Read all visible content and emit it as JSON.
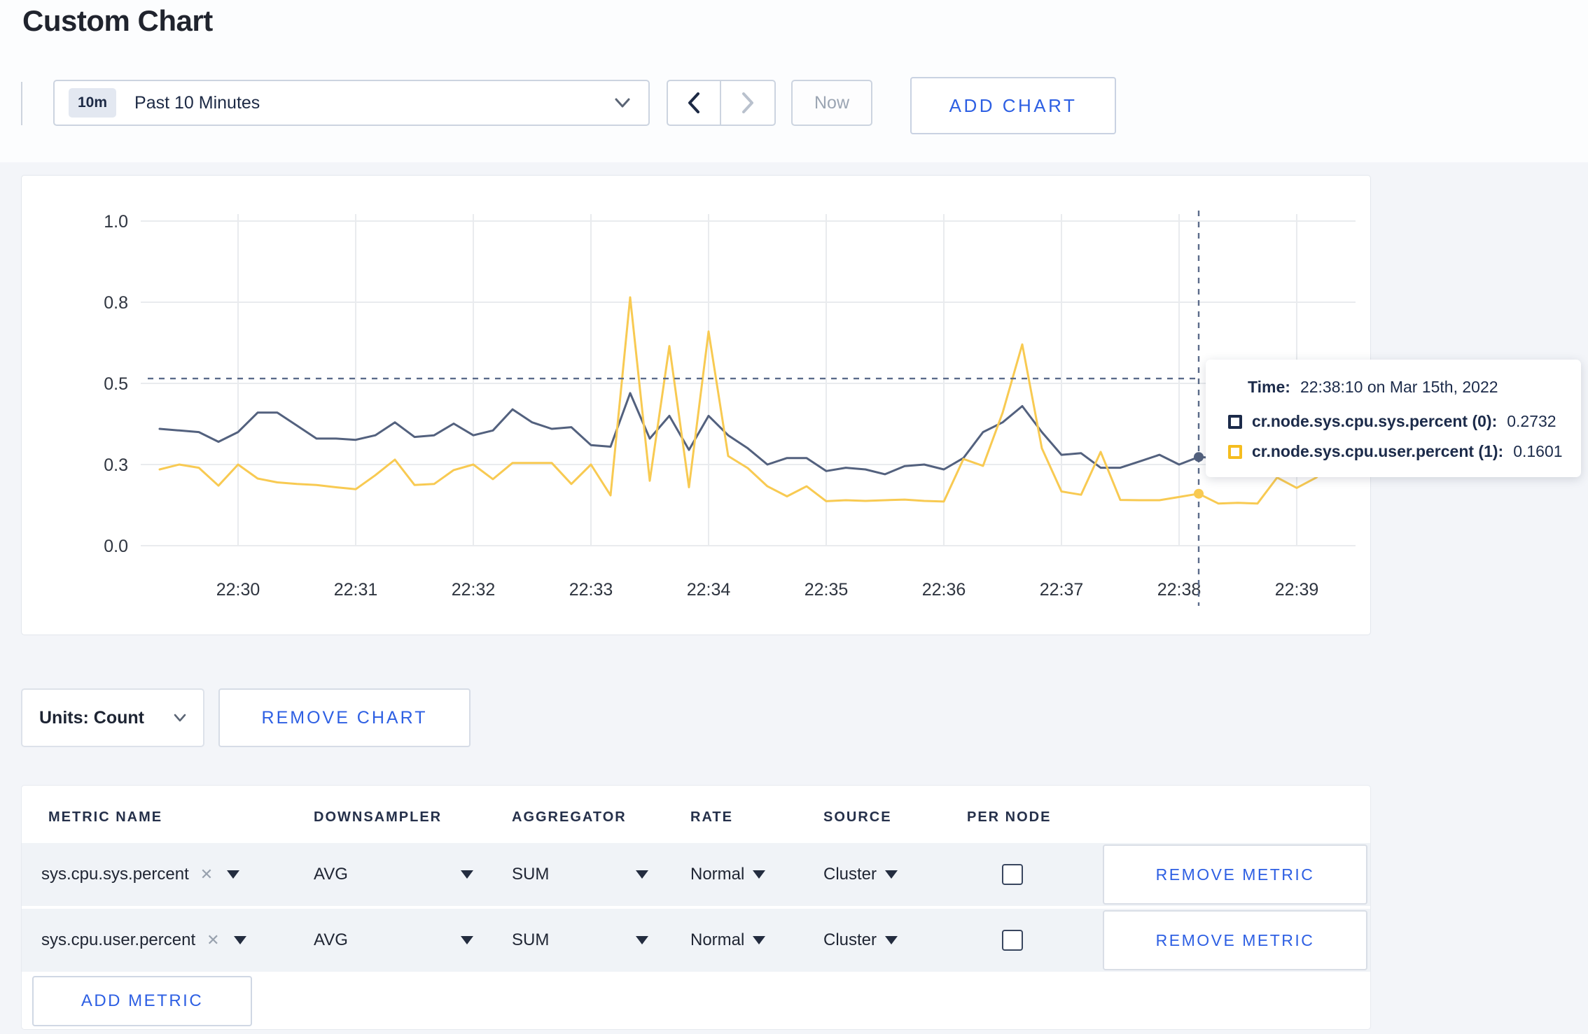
{
  "page": {
    "title": "Custom Chart"
  },
  "toolbar": {
    "time_badge": "10m",
    "time_label": "Past 10 Minutes",
    "now_label": "Now",
    "add_chart_label": "ADD CHART"
  },
  "chart_data": {
    "type": "line",
    "title": "",
    "xlabel": "",
    "ylabel": "",
    "ylim": [
      0,
      1
    ],
    "grid": true,
    "x_start_time": "22:29:20",
    "sample_interval_seconds": 10,
    "x_ticks": [
      "22:30",
      "22:31",
      "22:32",
      "22:33",
      "22:34",
      "22:35",
      "22:36",
      "22:37",
      "22:38",
      "22:39"
    ],
    "y_tick_labels": [
      "0.0",
      "0.3",
      "0.5",
      "0.8",
      "1.0"
    ],
    "y_tick_values": [
      0,
      0.25,
      0.5,
      0.75,
      1.0
    ],
    "series": [
      {
        "name": "cr.node.sys.cpu.sys.percent (0)",
        "color": "#53617e",
        "values": [
          0.36,
          0.355,
          0.35,
          0.32,
          0.35,
          0.41,
          0.41,
          0.37,
          0.33,
          0.33,
          0.326,
          0.34,
          0.38,
          0.335,
          0.34,
          0.376,
          0.34,
          0.355,
          0.42,
          0.38,
          0.36,
          0.365,
          0.31,
          0.305,
          0.47,
          0.33,
          0.4,
          0.295,
          0.4,
          0.34,
          0.3,
          0.25,
          0.27,
          0.27,
          0.23,
          0.24,
          0.235,
          0.22,
          0.245,
          0.25,
          0.235,
          0.27,
          0.35,
          0.38,
          0.43,
          0.35,
          0.28,
          0.285,
          0.24,
          0.24,
          0.26,
          0.28,
          0.25,
          0.2732,
          0.27,
          0.28,
          0.27,
          0.26,
          0.27,
          0.28,
          0.26,
          0.265
        ]
      },
      {
        "name": "cr.node.sys.cpu.user.percent (1)",
        "color": "#f8ca52",
        "values": [
          0.235,
          0.25,
          0.24,
          0.185,
          0.25,
          0.207,
          0.195,
          0.19,
          0.187,
          0.18,
          0.174,
          0.217,
          0.265,
          0.187,
          0.19,
          0.233,
          0.25,
          0.205,
          0.255,
          0.255,
          0.255,
          0.19,
          0.25,
          0.155,
          0.765,
          0.2,
          0.615,
          0.18,
          0.66,
          0.276,
          0.239,
          0.183,
          0.152,
          0.183,
          0.137,
          0.14,
          0.138,
          0.14,
          0.142,
          0.138,
          0.136,
          0.267,
          0.246,
          0.41,
          0.62,
          0.3,
          0.167,
          0.157,
          0.289,
          0.141,
          0.14,
          0.14,
          0.15,
          0.1601,
          0.13,
          0.132,
          0.13,
          0.21,
          0.178,
          0.21,
          0.27,
          0.22
        ]
      }
    ],
    "crosshair": {
      "sample_index": 53,
      "time": "22:38:10",
      "hover_value": 0.515,
      "color": "#5b6b8a"
    },
    "legend_position": "tooltip"
  },
  "tooltip": {
    "time_label": "Time:",
    "time_value": "22:38:10 on Mar 15th, 2022",
    "rows": [
      {
        "label": "cr.node.sys.cpu.sys.percent (0):",
        "value": "0.2732",
        "color": "#1c2b4a"
      },
      {
        "label": "cr.node.sys.cpu.user.percent (1):",
        "value": "0.1601",
        "color": "#f5bd1f"
      }
    ]
  },
  "units_bar": {
    "units_label": "Units: Count",
    "remove_chart_label": "REMOVE CHART"
  },
  "metrics_table": {
    "headers": [
      "METRIC NAME",
      "DOWNSAMPLER",
      "AGGREGATOR",
      "RATE",
      "SOURCE",
      "PER NODE"
    ],
    "rows": [
      {
        "metric": "sys.cpu.sys.percent",
        "downsampler": "AVG",
        "aggregator": "SUM",
        "rate": "Normal",
        "source": "Cluster",
        "per_node": false,
        "remove_label": "REMOVE METRIC"
      },
      {
        "metric": "sys.cpu.user.percent",
        "downsampler": "AVG",
        "aggregator": "SUM",
        "rate": "Normal",
        "source": "Cluster",
        "per_node": false,
        "remove_label": "REMOVE METRIC"
      }
    ],
    "add_metric_label": "ADD METRIC"
  },
  "colors": {
    "accent_blue": "#2d5fe3",
    "navy_text": "#1c2b4a",
    "grid": "#e9ebee",
    "axis_text": "#2f3540"
  }
}
